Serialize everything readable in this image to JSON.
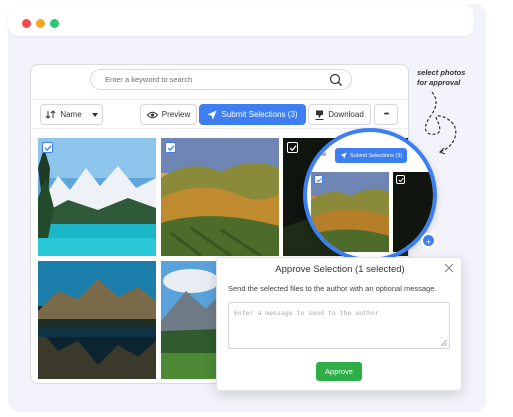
{
  "window": {
    "dots": [
      "#f04a4a",
      "#f4a623",
      "#2dc37a"
    ]
  },
  "search": {
    "placeholder": "Enter a keyword to search"
  },
  "toolbar": {
    "sort_label": "Name",
    "preview_label": "Preview",
    "submit_label": "Submit Selections (3)",
    "download_label": "Download",
    "more_label": "•••"
  },
  "annotation": {
    "line1": "select photos",
    "line2": "for approval"
  },
  "magnifier": {
    "preview_label": "eview",
    "submit_label": "Submit Selections (3)",
    "plus": "+"
  },
  "dialog": {
    "title": "Approve Selection (1 selected)",
    "message": "Send the selected files to the author with an optional message.",
    "textarea_placeholder": "Enter a message to send to the author",
    "approve_label": "Approve"
  },
  "colors": {
    "accent": "#3d7ff2",
    "approve": "#2fae48"
  }
}
